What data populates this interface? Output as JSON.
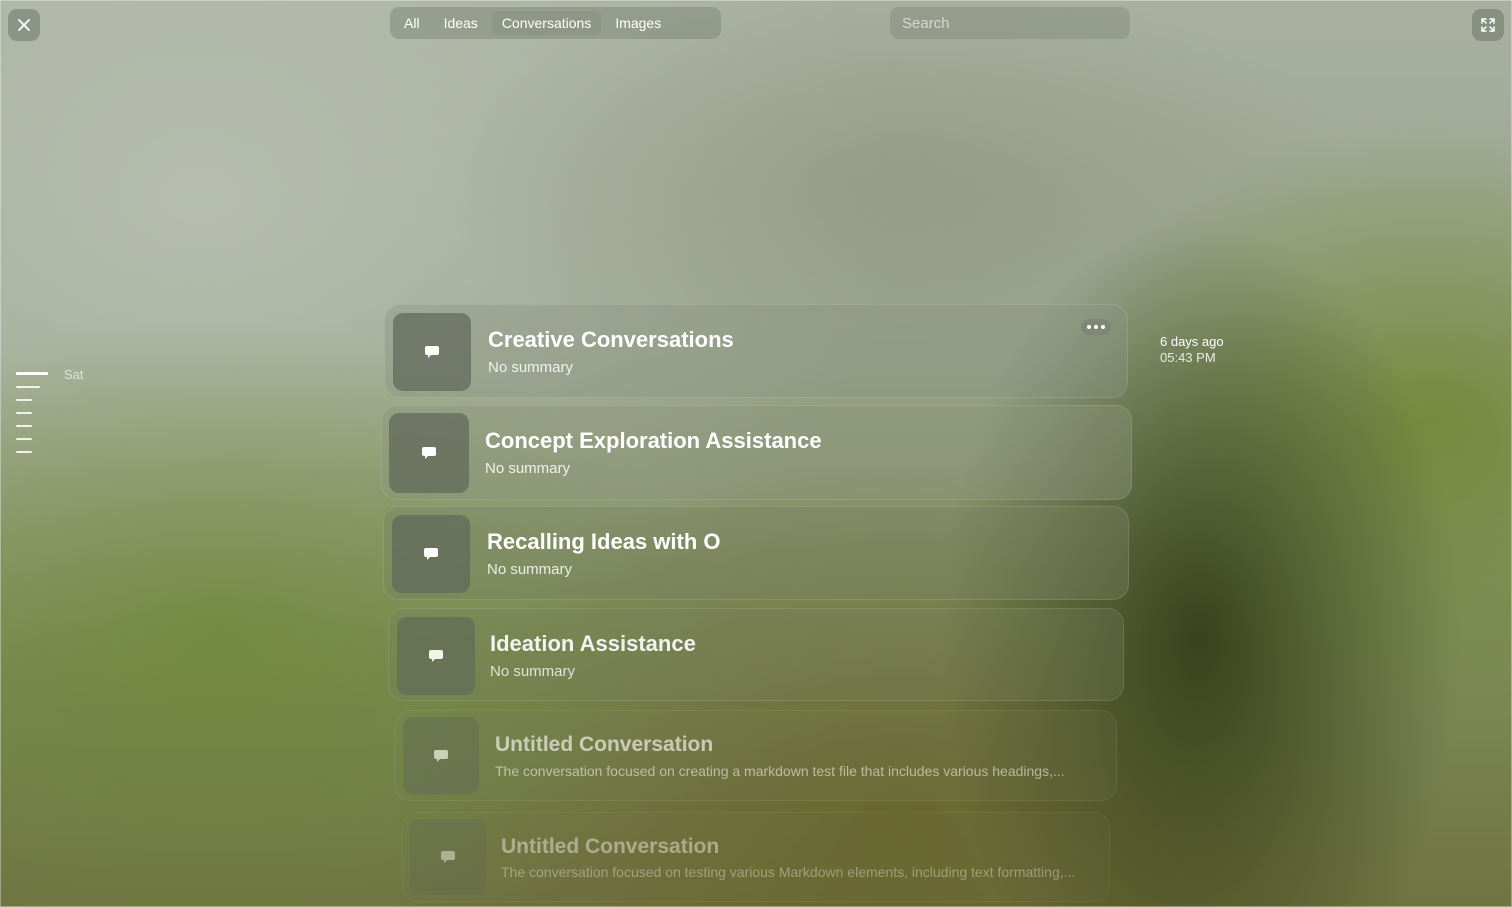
{
  "window": {
    "close_icon": "close-icon",
    "expand_icon": "expand-icon"
  },
  "tabs": [
    {
      "label": "All",
      "active": false
    },
    {
      "label": "Ideas",
      "active": false
    },
    {
      "label": "Conversations",
      "active": true
    },
    {
      "label": "Images",
      "active": false
    }
  ],
  "search": {
    "placeholder": "Search",
    "value": ""
  },
  "timeline": {
    "label": "Sat"
  },
  "selected_meta": {
    "relative": "6 days ago",
    "time": "05:43 PM"
  },
  "conversations": [
    {
      "title": "Creative Conversations",
      "summary": "No summary",
      "icon": "chat-bubble-icon"
    },
    {
      "title": "Concept Exploration Assistance",
      "summary": "No summary",
      "icon": "chat-bubble-icon"
    },
    {
      "title": "Recalling Ideas with O",
      "summary": "No summary",
      "icon": "chat-bubble-icon"
    },
    {
      "title": "Ideation Assistance",
      "summary": "No summary",
      "icon": "chat-bubble-icon"
    },
    {
      "title": "Untitled Conversation",
      "summary": "The conversation focused on creating a markdown test file that includes various headings,...",
      "icon": "chat-bubble-icon"
    },
    {
      "title": "Untitled Conversation",
      "summary": "The conversation focused on testing various Markdown elements, including text formatting,...",
      "icon": "chat-bubble-icon"
    }
  ],
  "colors": {
    "text": "#ffffff",
    "card_bg": "#8c9480"
  }
}
